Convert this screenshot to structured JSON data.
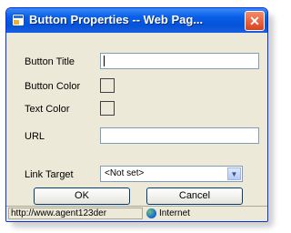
{
  "window": {
    "title": "Button Properties -- Web Pag...",
    "close_icon": "close-icon",
    "app_icon": "internet-explorer-icon"
  },
  "form": {
    "button_title_label": "Button Title",
    "button_title_value": "",
    "button_color_label": "Button Color",
    "text_color_label": "Text Color",
    "url_label": "URL",
    "url_value": "",
    "link_target_label": "Link Target",
    "link_target_value": "<Not set>"
  },
  "buttons": {
    "ok_label": "OK",
    "cancel_label": "Cancel"
  },
  "statusbar": {
    "url": "http://www.agent123der",
    "zone_label": "Internet",
    "zone_icon": "globe-icon"
  },
  "colors": {
    "titlebar": "#0553d9",
    "close_button": "#d9421c",
    "dialog_background": "#ece9d8"
  }
}
